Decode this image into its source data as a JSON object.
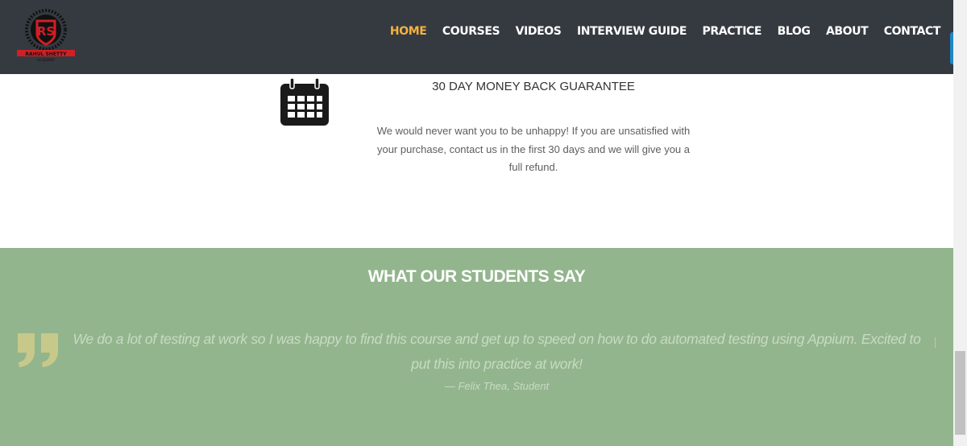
{
  "header": {
    "logo_text": "RAHUL SHETTY ACADEMY",
    "logo_tagline": "SECURE YOUR FUTURE",
    "nav": [
      {
        "label": "HOME",
        "active": true
      },
      {
        "label": "COURSES"
      },
      {
        "label": "VIDEOS"
      },
      {
        "label": "INTERVIEW GUIDE"
      },
      {
        "label": "PRACTICE"
      },
      {
        "label": "BLOG"
      },
      {
        "label": "ABOUT"
      },
      {
        "label": "CONTACT"
      }
    ]
  },
  "guarantee": {
    "icon": "calendar-icon",
    "title": "30 DAY MONEY BACK GUARANTEE",
    "text": "We would never want you to be unhappy! If you are unsatisfied with your purchase, contact us in the first 30 days and we will give you a full refund."
  },
  "testimonials": {
    "heading": "WHAT OUR STUDENTS SAY",
    "quote_icon": "quote-icon",
    "quote": "We do a lot of testing at work so I was happy to find this course and get up to speed on how to do automated testing using Appium. Excited to put this into practice at work!",
    "author": "— Felix Thea, Student"
  },
  "colors": {
    "header_bg": "#353a40",
    "nav_active": "#f3b23f",
    "testimonial_bg": "#93b58d",
    "quote_icon": "#c7c98a",
    "logo_red": "#d01f26"
  }
}
